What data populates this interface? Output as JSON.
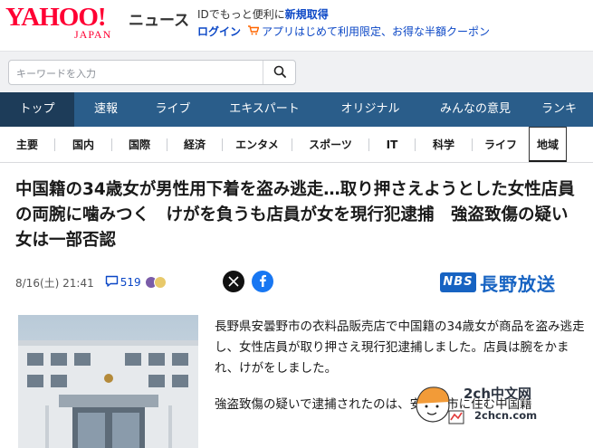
{
  "header": {
    "logo_main": "YAHOO!",
    "logo_sub": "JAPAN",
    "service_name": "ニュース",
    "promo_line1_text": "IDでもっと便利に",
    "promo_line1_link": "新規取得",
    "login_label": "ログイン",
    "app_promo": "アプリはじめて利用限定、お得な半額クーポン"
  },
  "search": {
    "placeholder": "キーワードを入力"
  },
  "main_nav": {
    "items": [
      {
        "label": "トップ"
      },
      {
        "label": "速報"
      },
      {
        "label": "ライブ"
      },
      {
        "label": "エキスパート"
      },
      {
        "label": "オリジナル"
      },
      {
        "label": "みんなの意見"
      },
      {
        "label": "ランキ"
      }
    ],
    "active": "トップ"
  },
  "sub_nav": {
    "items": [
      {
        "label": "主要"
      },
      {
        "label": "国内"
      },
      {
        "label": "国際"
      },
      {
        "label": "経済"
      },
      {
        "label": "エンタメ"
      },
      {
        "label": "スポーツ"
      },
      {
        "label": "IT"
      },
      {
        "label": "科学"
      },
      {
        "label": "ライフ"
      },
      {
        "label": "地域"
      }
    ],
    "active": "地域"
  },
  "article": {
    "headline": "中国籍の34歳女が男性用下着を盗み逃走…取り押さえようとした女性店員の両腕に噛みつく　けがを負うも店員が女を現行犯逮捕　強盗致傷の疑い　女は一部否認",
    "date": "8/16(土) 21:41",
    "comment_count": "519",
    "source_logo": "NBS",
    "source_name": "長野放送",
    "paragraphs": [
      "長野県安曇野市の衣料品販売店で中国籍の34歳女が商品を盗み逃走し、女性店員が取り押さえ現行犯逮捕しました。店員は腕をかまれ、けがをしました。",
      "強盗致傷の疑いで逮捕されたのは、安曇野市に住む中国籍"
    ]
  },
  "watermark": {
    "text1": "2ch中文网",
    "text2": "2chcn.com"
  },
  "colors": {
    "brand_red": "#ff0033",
    "nav_blue": "#2a5d8a",
    "nav_active": "#1d3c59",
    "link_blue": "#0b47c6",
    "nbs_blue": "#1763c2"
  }
}
